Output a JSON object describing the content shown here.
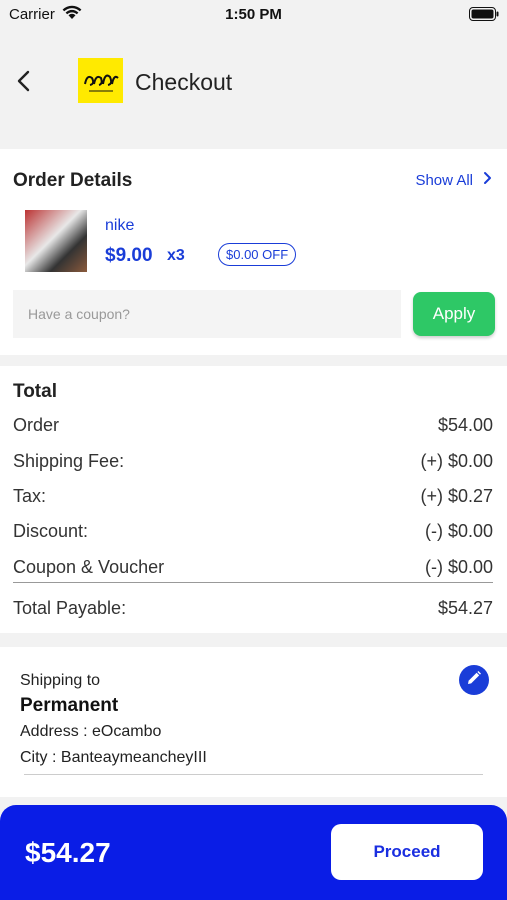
{
  "status_bar": {
    "carrier": "Carrier",
    "time": "1:50 PM"
  },
  "header": {
    "title": "Checkout",
    "logo_icon": "store-logo-icon"
  },
  "order_details": {
    "title": "Order Details",
    "show_all": "Show All",
    "item": {
      "name": "nike",
      "price": "$9.00",
      "quantity": "x3",
      "discount": "$0.00 OFF"
    },
    "coupon_placeholder": "Have a coupon?",
    "apply_label": "Apply"
  },
  "totals": {
    "title": "Total",
    "rows": [
      {
        "label": "Order",
        "value": "$54.00"
      },
      {
        "label": "Shipping Fee:",
        "value": "(+) $0.00"
      },
      {
        "label": "Tax:",
        "value": "(+) $0.27"
      },
      {
        "label": "Discount:",
        "value": "(-) $0.00"
      },
      {
        "label": "Coupon & Voucher",
        "value": "(-) $0.00"
      }
    ],
    "payable_label": "Total Payable:",
    "payable_value": "$54.27"
  },
  "shipping": {
    "label": "Shipping to",
    "name": "Permanent",
    "address": "Address : eOcambo",
    "city": "City : BanteaymeancheyIII"
  },
  "bottom": {
    "total": "$54.27",
    "proceed_label": "Proceed"
  },
  "colors": {
    "primary": "#0a1de6",
    "accent_text": "#1a3dd8",
    "apply": "#2ec866",
    "logo_bg": "#ffea00"
  }
}
